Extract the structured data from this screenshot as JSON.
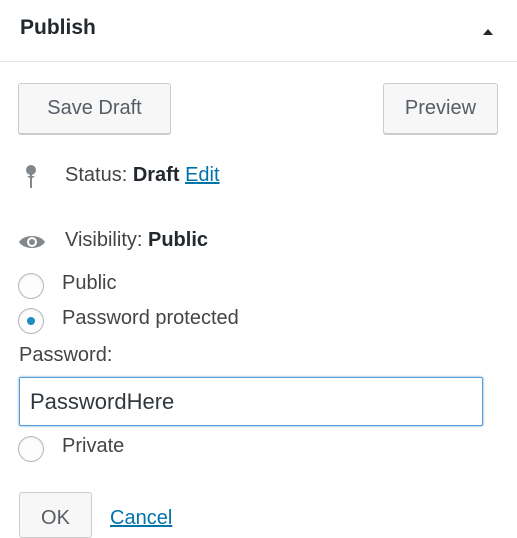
{
  "header": {
    "title": "Publish",
    "toggle_icon": "arrow-up-icon"
  },
  "actions": {
    "save_draft_label": "Save Draft",
    "preview_label": "Preview"
  },
  "status": {
    "icon": "pin-icon",
    "label": "Status:",
    "value": "Draft",
    "edit_link": "Edit"
  },
  "visibility": {
    "icon": "eye-icon",
    "label": "Visibility:",
    "value": "Public",
    "options": [
      {
        "label": "Public",
        "checked": false
      },
      {
        "label": "Password protected",
        "checked": true
      },
      {
        "label": "Private",
        "checked": false
      }
    ],
    "password_label": "Password:",
    "password_value": "PasswordHere",
    "ok_label": "OK",
    "cancel_label": "Cancel"
  },
  "colors": {
    "link": "#0073aa",
    "radio_checked": "#1e8cbe",
    "focus_border": "#5b9dd9"
  }
}
